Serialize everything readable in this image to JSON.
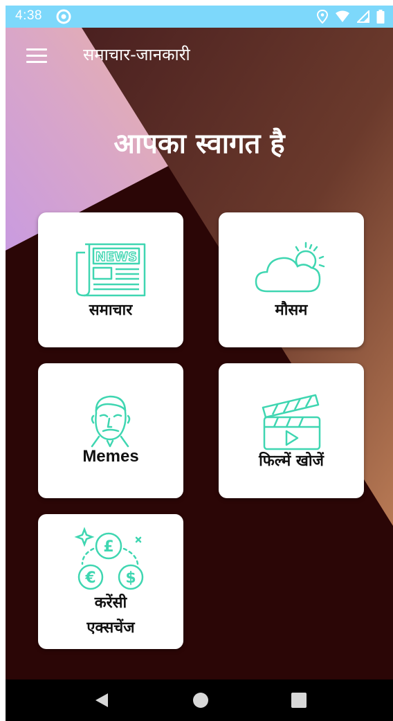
{
  "status_bar": {
    "time": "4:38",
    "icons": [
      "sync-icon",
      "location-icon",
      "wifi-icon",
      "signal-icon",
      "battery-icon"
    ]
  },
  "app_bar": {
    "title": "समाचार-जानकारी",
    "menu_icon": "hamburger-menu-icon"
  },
  "welcome_text": "आपका स्वागत है",
  "cards": [
    {
      "label": "समाचार",
      "icon": "newspaper-icon"
    },
    {
      "label": "मौसम",
      "icon": "weather-cloud-icon"
    },
    {
      "label": "Memes",
      "icon": "meme-face-icon"
    },
    {
      "label": "फिल्में खोजें",
      "icon": "clapperboard-icon"
    },
    {
      "label_line1": "करेंसी",
      "label_line2": "एक्सचेंज",
      "icon": "currency-exchange-icon"
    }
  ],
  "nav_bar": {
    "buttons": [
      "back-icon",
      "home-icon",
      "recents-icon"
    ]
  },
  "colors": {
    "status_bar": "#7dd8fb",
    "background_dark": "#2b0606",
    "accent_icon": "#3fd6b1",
    "card_bg": "#ffffff"
  }
}
